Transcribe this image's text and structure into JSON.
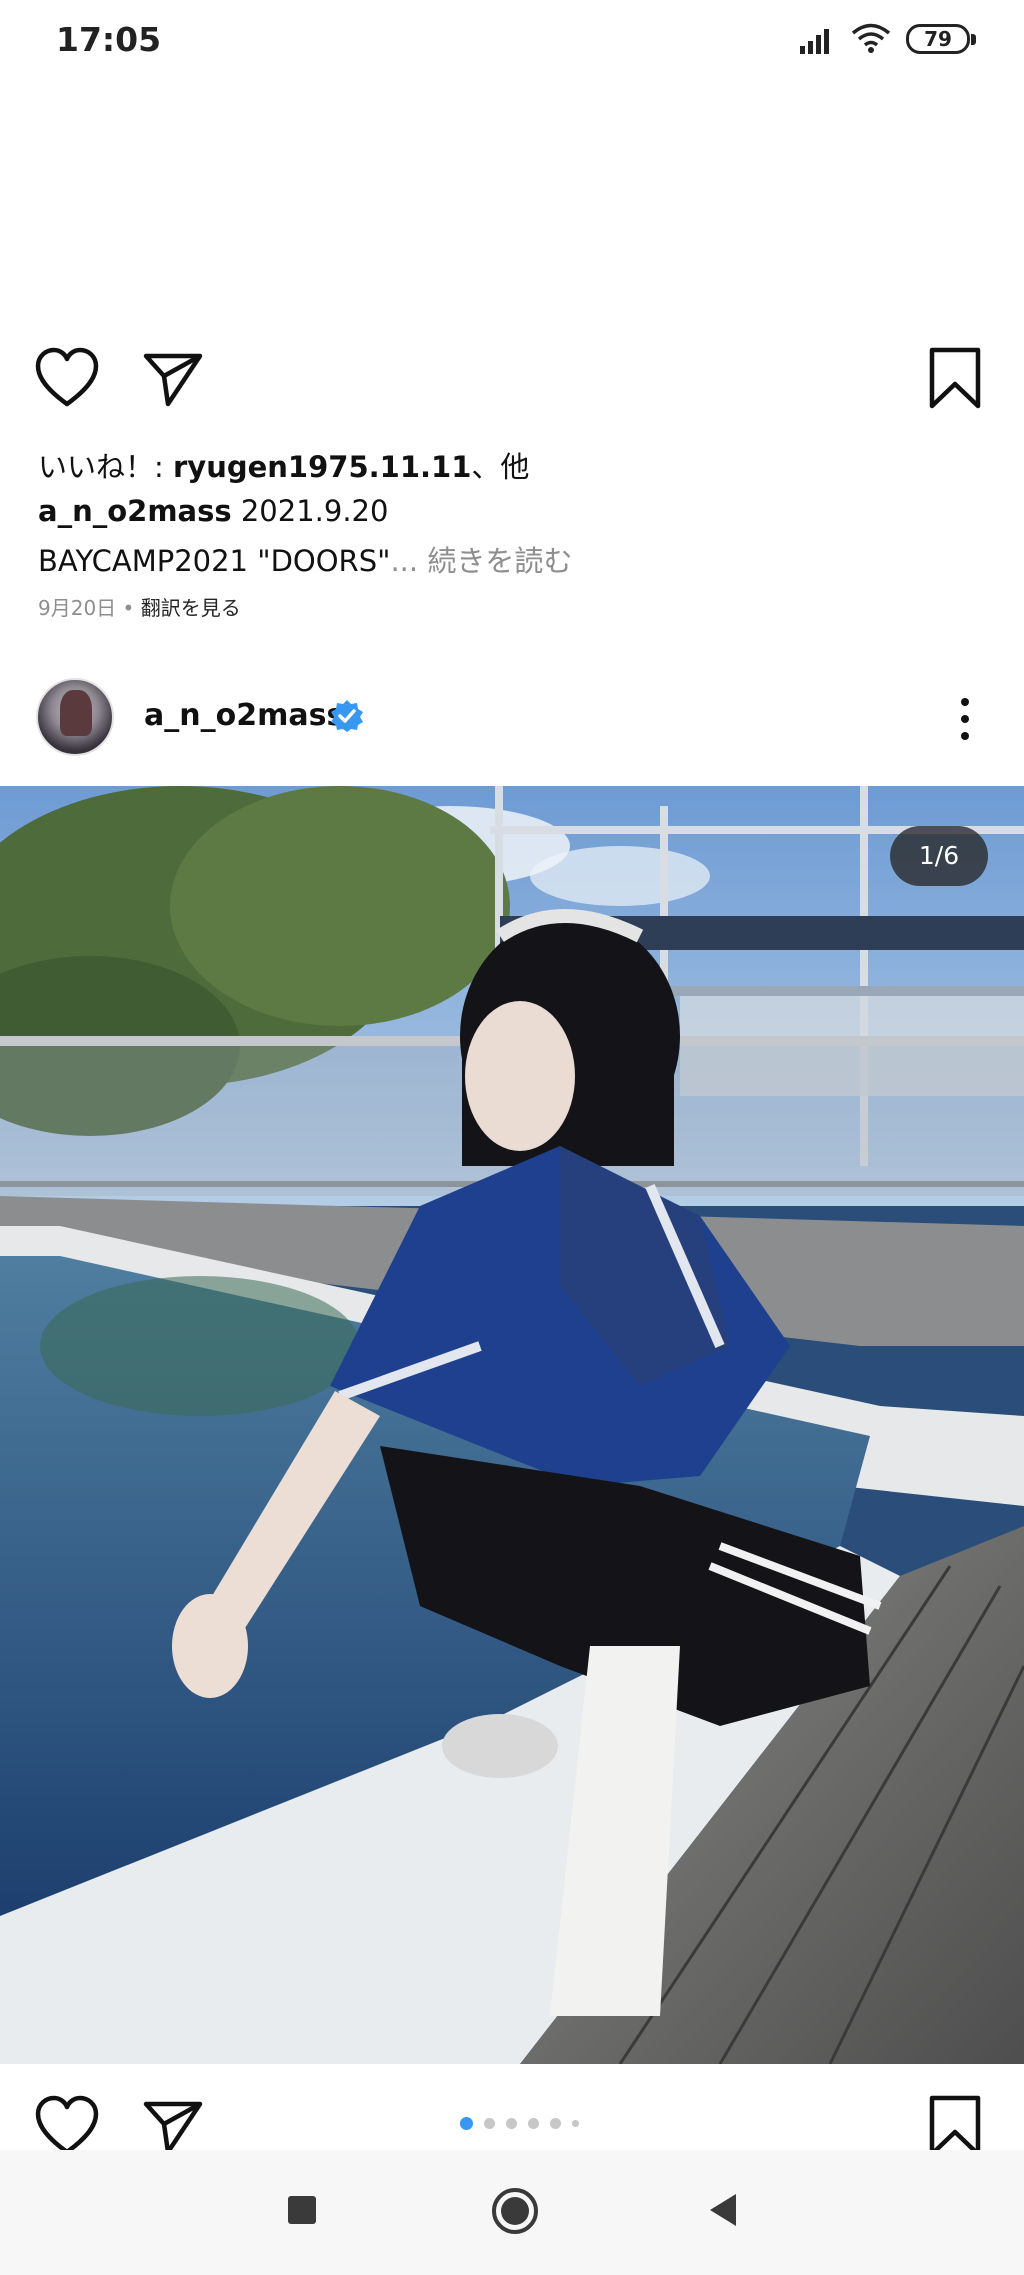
{
  "status_bar": {
    "time": "17:05",
    "battery": "79",
    "icons": [
      "signal-icon",
      "wifi-icon",
      "battery-icon"
    ]
  },
  "post_prev": {
    "likes_prefix": "いいね！: ",
    "likes_user": "ryugen1975.11.11",
    "likes_suffix": "、他",
    "caption_user": "a_n_o2mass",
    "caption_date": " 2021.9.20",
    "caption_text": "BAYCAMP2021 \"DOORS\"",
    "caption_more": "... 続きを読む",
    "date": "9月20日",
    "separator": " • ",
    "translate": "翻訳を見る"
  },
  "post": {
    "username": "a_n_o2mass",
    "counter": "1/6",
    "current_slide": 1,
    "total_slides": 6
  },
  "colors": {
    "verified": "#3897f0",
    "active_dot": "#3897f0",
    "inactive_dot": "#c7c7c7"
  },
  "icons": [
    "heart-icon",
    "share-icon",
    "bookmark-icon",
    "verified-badge-icon",
    "more-options-icon",
    "nav-recents-icon",
    "nav-home-icon",
    "nav-back-icon"
  ]
}
